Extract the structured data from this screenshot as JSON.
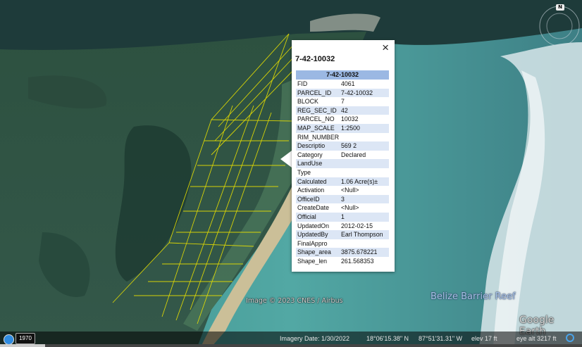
{
  "popup": {
    "title": "7-42-10032",
    "table_header": "7-42-10032",
    "close_glyph": "×",
    "rows": [
      {
        "k": "FID",
        "v": "4061"
      },
      {
        "k": "PARCEL_ID",
        "v": "7-42-10032"
      },
      {
        "k": "BLOCK",
        "v": "7"
      },
      {
        "k": "REG_SEC_ID",
        "v": "42"
      },
      {
        "k": "PARCEL_NO",
        "v": "10032"
      },
      {
        "k": "MAP_SCALE",
        "v": "1:2500"
      },
      {
        "k": "RIM_NUMBER",
        "v": ""
      },
      {
        "k": "Descriptio",
        "v": "569 2"
      },
      {
        "k": "Category",
        "v": "Declared"
      },
      {
        "k": "LandUse",
        "v": ""
      },
      {
        "k": "Type",
        "v": ""
      },
      {
        "k": "Calculated",
        "v": "1.06 Acre(s)±"
      },
      {
        "k": "Activation",
        "v": "<Null>"
      },
      {
        "k": "OfficeID",
        "v": "3"
      },
      {
        "k": "CreateDate",
        "v": "<Null>"
      },
      {
        "k": "Official",
        "v": "1"
      },
      {
        "k": "UpdatedOn",
        "v": "2012-02-15"
      },
      {
        "k": "UpdatedBy",
        "v": "Earl Thompson"
      },
      {
        "k": "FinalAppro",
        "v": ""
      },
      {
        "k": "Shape_area",
        "v": "3875.678221"
      },
      {
        "k": "Shape_len",
        "v": "261.568353"
      }
    ]
  },
  "map": {
    "reef_label": "Belize Barrier Reef",
    "image_credit": "Image © 2023 CNES / Airbus",
    "logo": "Google Earth",
    "north_label": "N",
    "parcel_outline_color": "#e8e000"
  },
  "status": {
    "year": "1970",
    "imagery_date": "Imagery Date: 1/30/2022",
    "lat": "18°06'15.38\" N",
    "lon": "87°51'31.31\" W",
    "elev": "elev   17 ft",
    "eye_alt": "eye alt  3217 ft"
  },
  "icons": {
    "history": "clock-icon",
    "close": "close-icon",
    "compass": "compass-icon",
    "streaming": "streaming-ring-icon"
  }
}
